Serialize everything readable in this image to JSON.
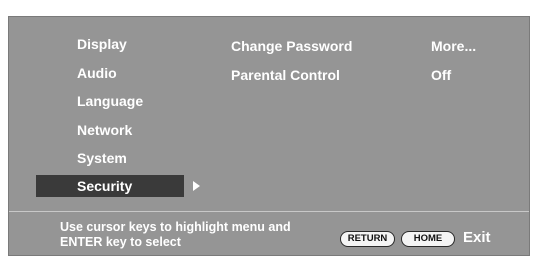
{
  "menu": {
    "items": [
      {
        "label": "Display"
      },
      {
        "label": "Audio"
      },
      {
        "label": "Language"
      },
      {
        "label": "Network"
      },
      {
        "label": "System"
      },
      {
        "label": "Security",
        "selected": true
      }
    ]
  },
  "security_settings": [
    {
      "name": "Change Password",
      "value": "More..."
    },
    {
      "name": "Parental Control",
      "value": "Off"
    }
  ],
  "footer": {
    "hint_line1": "Use cursor keys to highlight menu and",
    "hint_line2": "ENTER key to select",
    "return_label": "RETURN",
    "home_label": "HOME",
    "exit_label": "Exit"
  },
  "colors": {
    "panel_background": "#959595",
    "selected_background": "#3a3a3a",
    "text": "#ffffff"
  },
  "icons": {
    "selection_arrow": "right-triangle"
  }
}
